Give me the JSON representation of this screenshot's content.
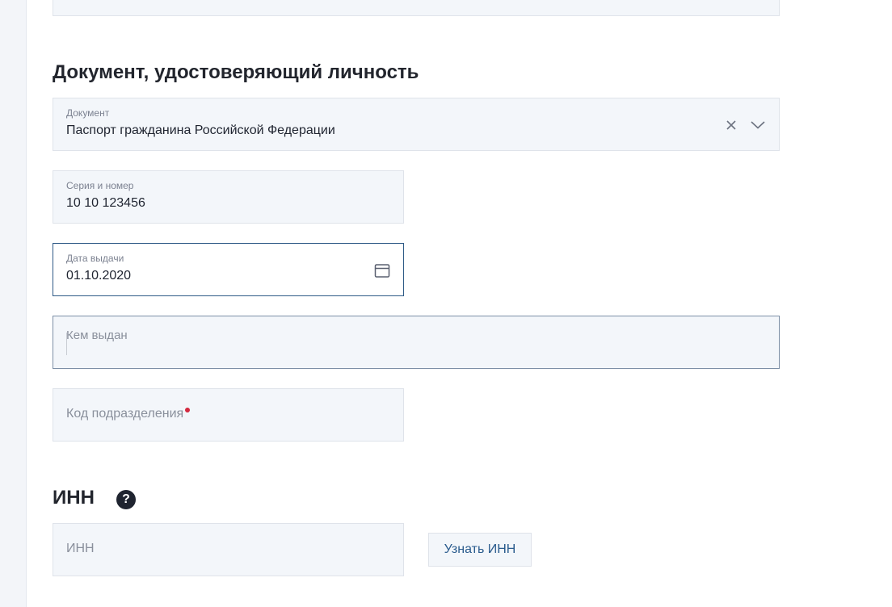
{
  "top_field": {
    "value": ""
  },
  "identity_section": {
    "title": "Документ, удостоверяющий личность"
  },
  "document_select": {
    "label": "Документ",
    "value": "Паспорт гражданина Российской Федерации"
  },
  "series_number": {
    "label": "Серия и номер",
    "value": "10 10 123456"
  },
  "issue_date": {
    "label": "Дата выдачи",
    "value": "01.10.2020"
  },
  "issued_by": {
    "placeholder": "Кем выдан"
  },
  "division_code": {
    "placeholder": "Код подразделения",
    "required": true
  },
  "inn_section": {
    "title": "ИНН",
    "help_symbol": "?"
  },
  "inn_field": {
    "placeholder": "ИНН"
  },
  "find_inn_button": {
    "label": "Узнать ИНН"
  },
  "colors": {
    "accent": "#2e5a86",
    "required": "#d3293f",
    "field_bg": "#f3f6fa"
  },
  "icons": {
    "clear": "close-icon",
    "dropdown": "chevron-down-icon",
    "date": "calendar-icon",
    "help": "help-icon"
  }
}
